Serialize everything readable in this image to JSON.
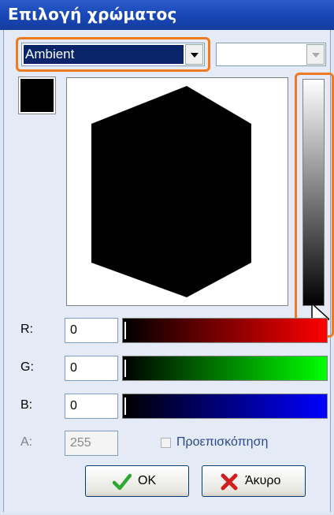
{
  "window": {
    "title": "Επιλογή χρώματος"
  },
  "material_select": {
    "value": "Ambient"
  },
  "secondary_select": {
    "value": ""
  },
  "channels": {
    "r": {
      "label": "R:",
      "value": "0",
      "color": "#ff0000"
    },
    "g": {
      "label": "G:",
      "value": "0",
      "color": "#00ff00"
    },
    "b": {
      "label": "B:",
      "value": "0",
      "color": "#0000ff"
    },
    "a": {
      "label": "A:",
      "value": "255"
    }
  },
  "current_color": "#000000",
  "preview": {
    "label": "Προεπισκόπηση",
    "checked": false
  },
  "buttons": {
    "ok": "OK",
    "cancel": "Άκυρο"
  },
  "colors": {
    "titlebar": "#1947b8",
    "highlight": "#f07a20",
    "ok_icon": "#2fa82f",
    "cancel_icon": "#d11f1f"
  },
  "icons": [
    "checkmark-icon",
    "x-icon",
    "mouse-cursor-icon"
  ]
}
